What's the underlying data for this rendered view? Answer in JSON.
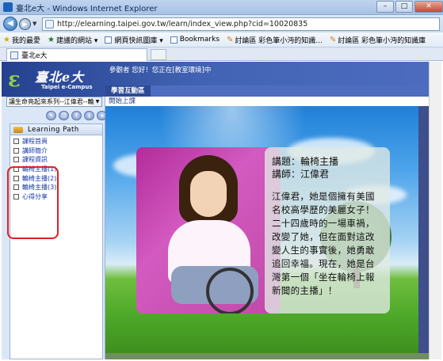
{
  "window": {
    "title": "臺北e大 - Windows Internet Explorer"
  },
  "browser": {
    "url": "http://elearning.taipei.gov.tw/learn/index_view.php?cid=10020835",
    "favorites": [
      {
        "label": "我的最愛",
        "icon": "star-icon"
      },
      {
        "label": "建議的網站 ▾",
        "icon": "suggested-sites-icon"
      },
      {
        "label": "網頁快訊圖庫 ▾",
        "icon": "web-slice-icon"
      },
      {
        "label": "Bookmarks",
        "icon": "page-icon"
      },
      {
        "label": "討論區 彩色筆小沔的知識...",
        "icon": "pen-icon"
      },
      {
        "label": "討論區 彩色筆小沔的知識庫",
        "icon": "pen-icon"
      }
    ],
    "tab_title": "臺北e大"
  },
  "site": {
    "logo_text": "臺北e大",
    "logo_subtext": "Taipei e-Campus",
    "welcome": "參觀者 您好！您正在[教室環境]中",
    "tab_label": "學習互動區",
    "action_link": "開始上課"
  },
  "sidebar": {
    "course_select_value": "讓生命亮起來系列--江偉君--輪",
    "panel_title": "Learning Path",
    "items": [
      {
        "label": "課程首頁"
      },
      {
        "label": "講師簡介"
      },
      {
        "label": "課程資訊"
      },
      {
        "label": "輪椅主播(1)"
      },
      {
        "label": "輪椅主播(2)"
      },
      {
        "label": "輪椅主播(3)"
      },
      {
        "label": "心得分享"
      }
    ]
  },
  "content": {
    "topic": "講題：輪椅主播",
    "lecturer": "講師：江偉君",
    "description": "江偉君，她是個擁有美國名校高學歷的美麗女子！二十四歲時的一場車禍，改變了她，但在面對這改變人生的事實後，她勇敢追回幸福。現在，她是台灣第一個「坐在輪椅上報新聞的主播」！"
  }
}
